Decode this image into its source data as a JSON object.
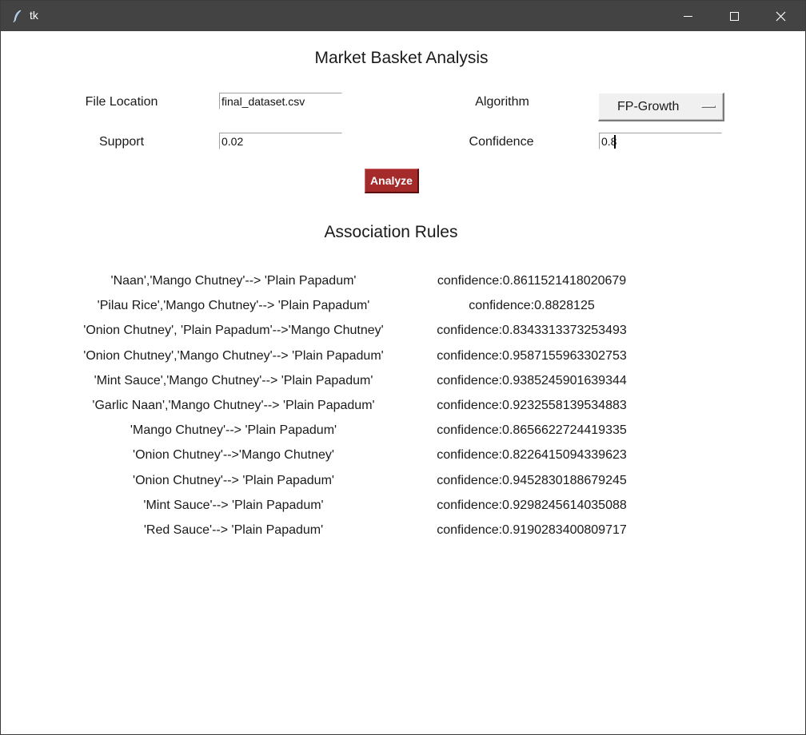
{
  "window": {
    "title": "tk"
  },
  "app": {
    "heading": "Market Basket Analysis",
    "file_location": {
      "label": "File Location",
      "value": "final_dataset.csv"
    },
    "support": {
      "label": "Support",
      "value": "0.02"
    },
    "algorithm": {
      "label": "Algorithm",
      "selected": "FP-Growth"
    },
    "confidence": {
      "label": "Confidence",
      "value": "0.8"
    },
    "analyze_label": "Analyze",
    "rules_heading": "Association Rules",
    "accent_color": "#a52a2a"
  },
  "rules": [
    {
      "rule": "'Naan','Mango Chutney'--> 'Plain Papadum'",
      "confidence": "confidence:0.8611521418020679"
    },
    {
      "rule": "'Pilau Rice','Mango Chutney'--> 'Plain Papadum'",
      "confidence": "confidence:0.8828125"
    },
    {
      "rule": "'Onion Chutney', 'Plain Papadum'-->'Mango Chutney'",
      "confidence": "confidence:0.8343313373253493"
    },
    {
      "rule": "'Onion Chutney','Mango Chutney'--> 'Plain Papadum'",
      "confidence": "confidence:0.9587155963302753"
    },
    {
      "rule": "'Mint Sauce','Mango Chutney'--> 'Plain Papadum'",
      "confidence": "confidence:0.9385245901639344"
    },
    {
      "rule": "'Garlic Naan','Mango Chutney'--> 'Plain Papadum'",
      "confidence": "confidence:0.9232558139534883"
    },
    {
      "rule": "'Mango Chutney'--> 'Plain Papadum'",
      "confidence": "confidence:0.8656622724419335"
    },
    {
      "rule": "'Onion Chutney'-->'Mango Chutney'",
      "confidence": "confidence:0.8226415094339623"
    },
    {
      "rule": "'Onion Chutney'--> 'Plain Papadum'",
      "confidence": "confidence:0.9452830188679245"
    },
    {
      "rule": "'Mint Sauce'--> 'Plain Papadum'",
      "confidence": "confidence:0.9298245614035088"
    },
    {
      "rule": "'Red Sauce'--> 'Plain Papadum'",
      "confidence": "confidence:0.9190283400809717"
    }
  ]
}
